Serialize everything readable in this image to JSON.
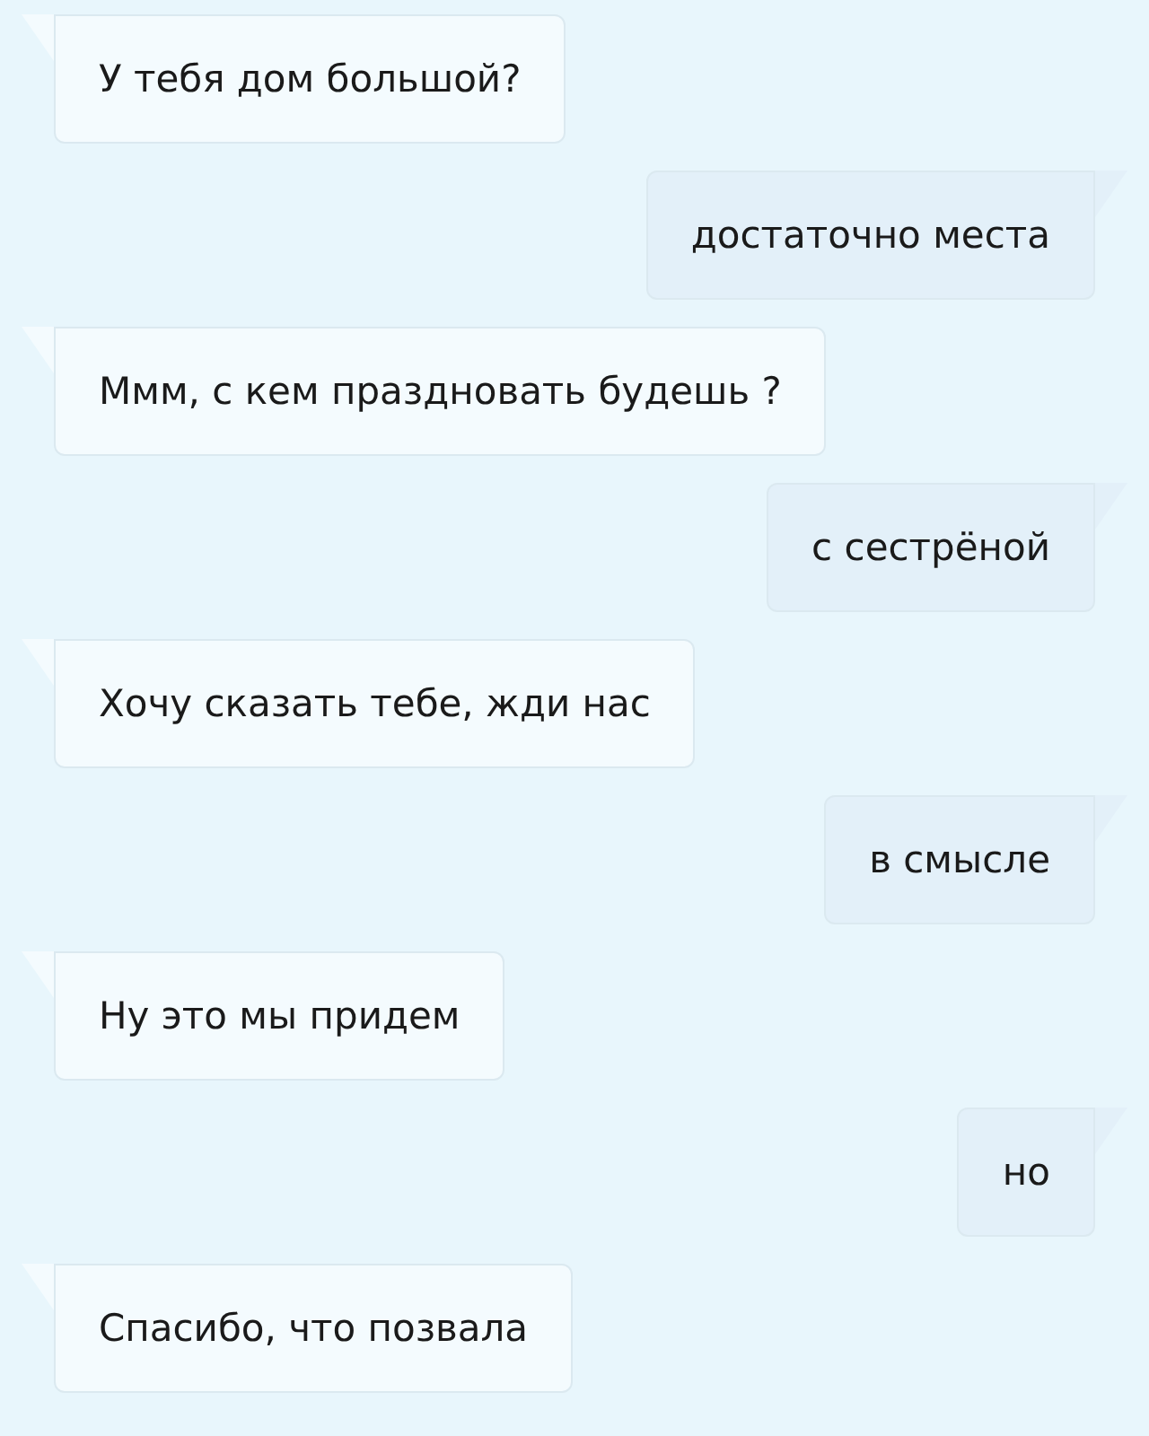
{
  "messages": [
    {
      "kind": "incoming",
      "text": "У тебя дом большой?"
    },
    {
      "kind": "outgoing",
      "text": "достаточно места"
    },
    {
      "kind": "incoming",
      "text": "Ммм, с кем праздновать будешь ?"
    },
    {
      "kind": "outgoing",
      "text": "с сестрёной"
    },
    {
      "kind": "incoming",
      "text": "Хочу сказать тебе, жди нас"
    },
    {
      "kind": "outgoing",
      "text": "в смысле"
    },
    {
      "kind": "incoming",
      "text": "Ну это мы придем"
    },
    {
      "kind": "outgoing",
      "text": "но"
    },
    {
      "kind": "incoming",
      "text": "Спасибо, что позвала"
    }
  ]
}
